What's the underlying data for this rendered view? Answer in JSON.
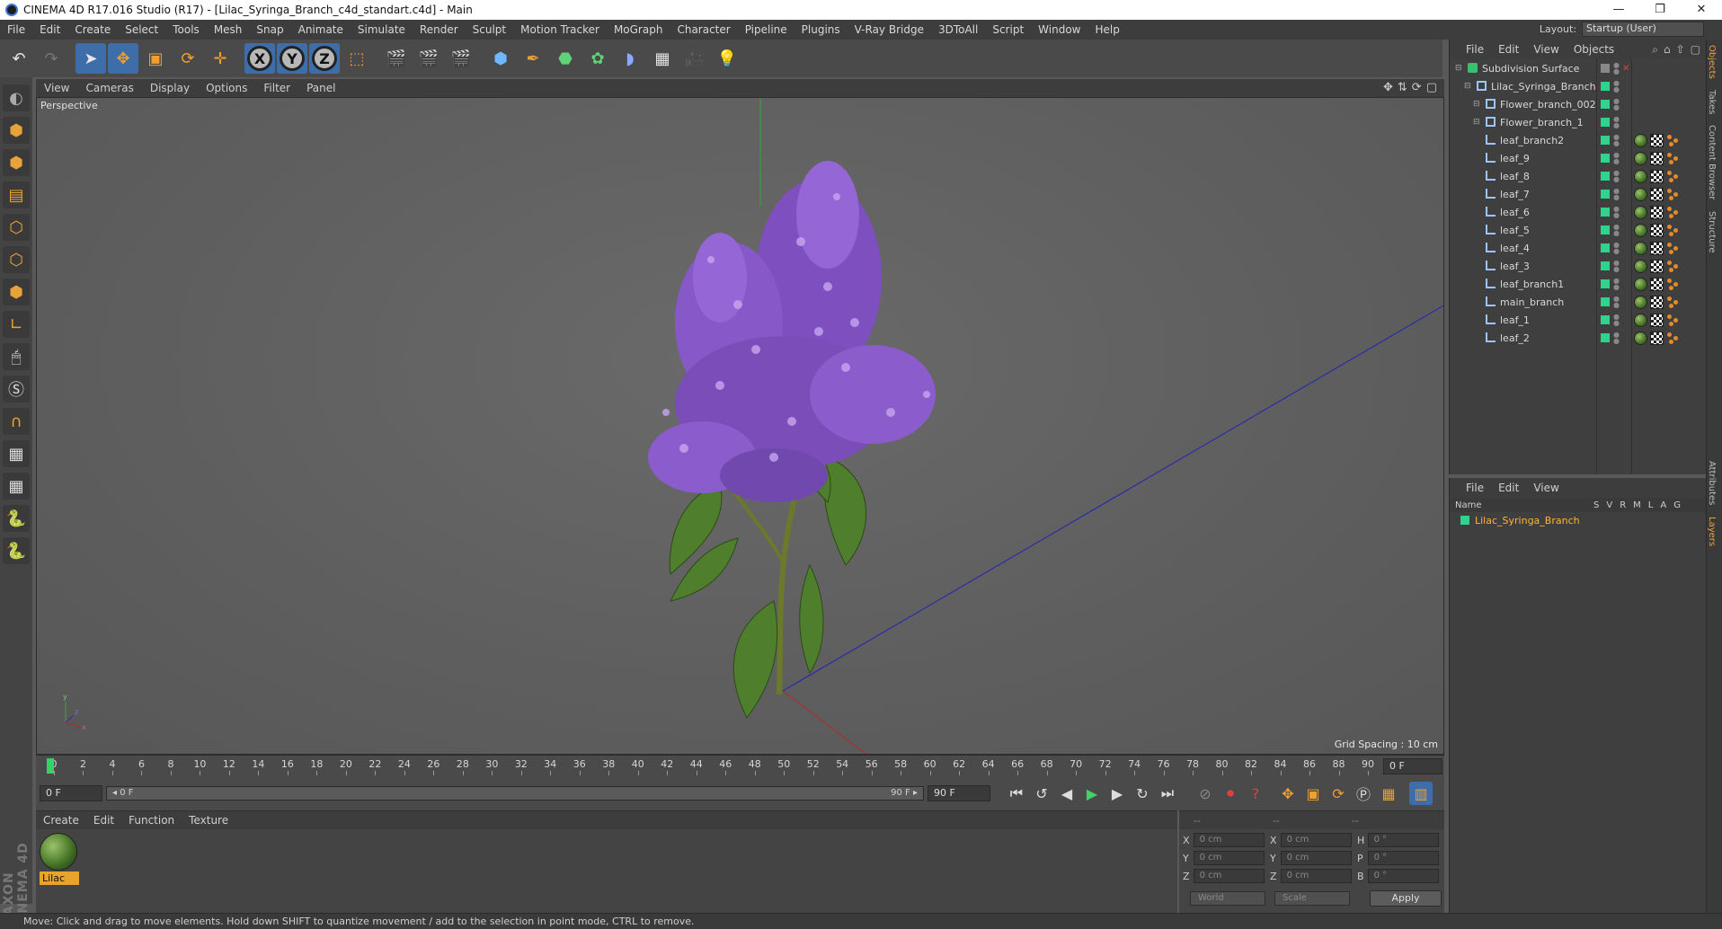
{
  "window": {
    "title": "CINEMA 4D R17.016 Studio (R17) - [Lilac_Syringa_Branch_c4d_standart.c4d] - Main",
    "controls": [
      "—",
      "❐",
      "✕"
    ]
  },
  "menubar": {
    "items": [
      "File",
      "Edit",
      "Create",
      "Select",
      "Tools",
      "Mesh",
      "Snap",
      "Animate",
      "Simulate",
      "Render",
      "Sculpt",
      "Motion Tracker",
      "MoGraph",
      "Character",
      "Pipeline",
      "Plugins",
      "V-Ray Bridge",
      "3DToAll",
      "Script",
      "Window",
      "Help"
    ],
    "layout_label": "Layout:",
    "layout_value": "Startup (User)"
  },
  "toolbar": {
    "axis_x": "X",
    "axis_y": "Y",
    "axis_z": "Z"
  },
  "viewport": {
    "menu": [
      "View",
      "Cameras",
      "Display",
      "Options",
      "Filter",
      "Panel"
    ],
    "camera_label": "Perspective",
    "grid_spacing": "Grid Spacing : 10 cm"
  },
  "timeline": {
    "ticks": [
      "0",
      "2",
      "4",
      "6",
      "8",
      "10",
      "12",
      "14",
      "16",
      "18",
      "20",
      "22",
      "24",
      "26",
      "28",
      "30",
      "32",
      "34",
      "36",
      "38",
      "40",
      "42",
      "44",
      "46",
      "48",
      "50",
      "52",
      "54",
      "56",
      "58",
      "60",
      "62",
      "64",
      "66",
      "68",
      "70",
      "72",
      "74",
      "76",
      "78",
      "80",
      "82",
      "84",
      "86",
      "88",
      "90"
    ],
    "current_frame": "0 F"
  },
  "transport": {
    "start_field": "0 F",
    "range_start": "◂ 0 F",
    "range_end": "90 F ▸",
    "end_field": "90 F"
  },
  "material_manager": {
    "menu": [
      "Create",
      "Edit",
      "Function",
      "Texture"
    ],
    "material_name": "Lilac"
  },
  "coordinates": {
    "header": [
      "--",
      "--",
      "--"
    ],
    "rows": [
      {
        "a": "X",
        "av": "0 cm",
        "b": "X",
        "bv": "0 cm",
        "c": "H",
        "cv": "0 °"
      },
      {
        "a": "Y",
        "av": "0 cm",
        "b": "Y",
        "bv": "0 cm",
        "c": "P",
        "cv": "0 °"
      },
      {
        "a": "Z",
        "av": "0 cm",
        "b": "Z",
        "bv": "0 cm",
        "c": "B",
        "cv": "0 °"
      }
    ],
    "space": "World",
    "mode": "Scale",
    "apply_label": "Apply"
  },
  "object_manager": {
    "menu": [
      "File",
      "Edit",
      "View",
      "Objects"
    ],
    "objects": [
      {
        "name": "Subdivision Surface",
        "indent": 0,
        "kind": "subdiv",
        "tags": false
      },
      {
        "name": "Lilac_Syringa_Branch",
        "indent": 1,
        "kind": "null",
        "tags": false
      },
      {
        "name": "Flower_branch_002",
        "indent": 2,
        "kind": "null",
        "tags": false
      },
      {
        "name": "Flower_branch_1",
        "indent": 2,
        "kind": "null",
        "tags": false
      },
      {
        "name": "leaf_branch2",
        "indent": 2,
        "kind": "poly",
        "tags": true
      },
      {
        "name": "leaf_9",
        "indent": 2,
        "kind": "poly",
        "tags": true
      },
      {
        "name": "leaf_8",
        "indent": 2,
        "kind": "poly",
        "tags": true
      },
      {
        "name": "leaf_7",
        "indent": 2,
        "kind": "poly",
        "tags": true
      },
      {
        "name": "leaf_6",
        "indent": 2,
        "kind": "poly",
        "tags": true
      },
      {
        "name": "leaf_5",
        "indent": 2,
        "kind": "poly",
        "tags": true
      },
      {
        "name": "leaf_4",
        "indent": 2,
        "kind": "poly",
        "tags": true
      },
      {
        "name": "leaf_3",
        "indent": 2,
        "kind": "poly",
        "tags": true
      },
      {
        "name": "leaf_branch1",
        "indent": 2,
        "kind": "poly",
        "tags": true
      },
      {
        "name": "main_branch",
        "indent": 2,
        "kind": "poly",
        "tags": true
      },
      {
        "name": "leaf_1",
        "indent": 2,
        "kind": "poly",
        "tags": true
      },
      {
        "name": "leaf_2",
        "indent": 2,
        "kind": "poly",
        "tags": true
      }
    ]
  },
  "layer_manager": {
    "menu": [
      "File",
      "Edit",
      "View"
    ],
    "col_name": "Name",
    "cols": [
      "S",
      "V",
      "R",
      "M",
      "L",
      "A",
      "G"
    ],
    "layers": [
      {
        "name": "Lilac_Syringa_Branch",
        "color": "#2fd38d"
      }
    ]
  },
  "side_tabs": [
    "Objects",
    "Takes",
    "Content Browser",
    "Structure",
    "Attributes",
    "Layers"
  ],
  "status": "Move: Click and drag to move elements. Hold down SHIFT to quantize movement / add to the selection in point mode, CTRL to remove.",
  "colors": {
    "accent_orange": "#e7a32a",
    "selection_blue": "#3e6eaa",
    "layer_green": "#2fd38d",
    "lilac_purple": "#8a55c9",
    "leaf_green": "#4f7f2c"
  }
}
